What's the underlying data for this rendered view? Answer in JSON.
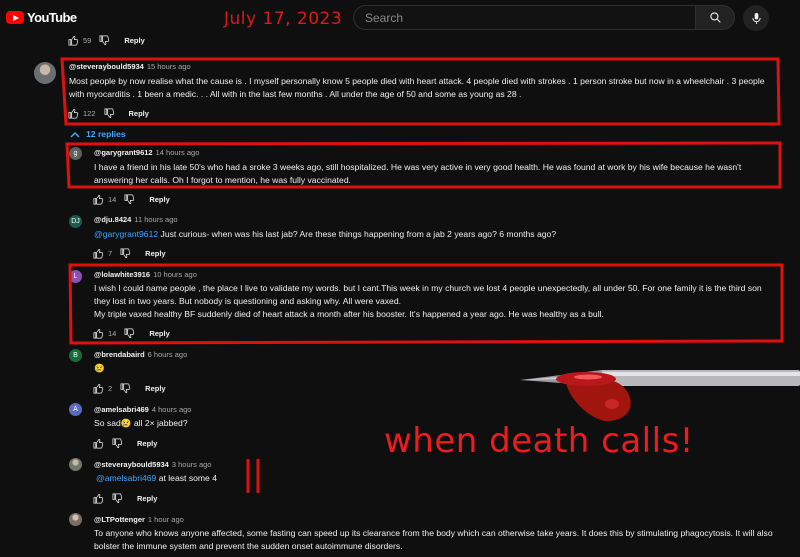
{
  "header": {
    "logo_text": "YouTube",
    "date_stamp": "July 17, 2023",
    "search_placeholder": "Search"
  },
  "top_actions": {
    "likes": "59",
    "reply_label": "Reply"
  },
  "main_comment": {
    "handle": "@steveraybould5934",
    "time": "15 hours ago",
    "text": "Most people by now realise what the cause is . I myself personally know 5 people died with heart attack. 4 people died with strokes . 1 person stroke but now in a wheelchair . 3 people with myocarditis . 1 been a medic. . . All with in the last few months . All under the age of 50 and some as young as 28 .",
    "likes": "122",
    "reply_label": "Reply",
    "replies_toggle": "12 replies"
  },
  "replies": [
    {
      "avatar_letter": "g",
      "avatar_color": "#5f5f5f",
      "handle": "@garygrant9612",
      "time": "14 hours ago",
      "mention": "",
      "text": "I have a friend in his late 50's who had a sroke 3 weeks ago, still hospitalized. He was very active in very good health. He was found at work by his wife because he wasn't answering her calls. Oh I forgot to mention, he was fully vaccinated.",
      "likes": "14",
      "reply_label": "Reply"
    },
    {
      "avatar_letter": "DJ",
      "avatar_color": "#1e5a4b",
      "handle": "@dju.8424",
      "time": "11 hours ago",
      "mention": "@garygrant9612",
      "text": "Just curious- when was his last jab? Are these things happening from a jab 2 years ago? 6 months ago?",
      "likes": "7",
      "reply_label": "Reply"
    },
    {
      "avatar_letter": "L",
      "avatar_color": "#8e4fb3",
      "handle": "@lolawhite3916",
      "time": "10 hours ago",
      "mention": "",
      "text": "I wish I could name people , the place I live to validate my words. but I cant.This week in my church we lost 4 people unexpectedly, all under 50. For one family it is the third son they lost in two years. But nobody is questioning and asking why. All were vaxed.",
      "text2": "My triple vaxed healthy BF suddenly died of heart attack a month after his booster. It's happened a year ago. He was healthy as a bull.",
      "likes": "14",
      "reply_label": "Reply"
    },
    {
      "avatar_letter": "B",
      "avatar_color": "#1b6b3a",
      "handle": "@brendabaird",
      "time": "6 hours ago",
      "mention": "",
      "text": "😢",
      "likes": "2",
      "reply_label": "Reply"
    },
    {
      "avatar_letter": "A",
      "avatar_color": "#5c6bc0",
      "handle": "@amelsabri469",
      "time": "4 hours ago",
      "mention": "",
      "text": "So sad😢 all 2× jabbed?",
      "likes": "",
      "reply_label": "Reply"
    },
    {
      "avatar_letter": "",
      "avatar_color": "#6d7a6a",
      "handle": "@steveraybould5934",
      "time": "3 hours ago",
      "mention": "@amelsabri469",
      "text": "at least some 4",
      "likes": "",
      "reply_label": "Reply"
    },
    {
      "avatar_letter": "",
      "avatar_color": "#7a6f66",
      "handle": "@LTPottenger",
      "time": "1 hour ago",
      "mention": "",
      "text": "To anyone who knows anyone affected, some fasting can speed up its clearance from the body which can otherwise take years. It does this by stimulating phagocytosis. It will also bolster the immune system and prevent the sudden onset autoimmune disorders.",
      "likes": "",
      "reply_label": ""
    }
  ],
  "overlay": {
    "caption": "when death calls!",
    "annotation_color": "#e01010"
  }
}
